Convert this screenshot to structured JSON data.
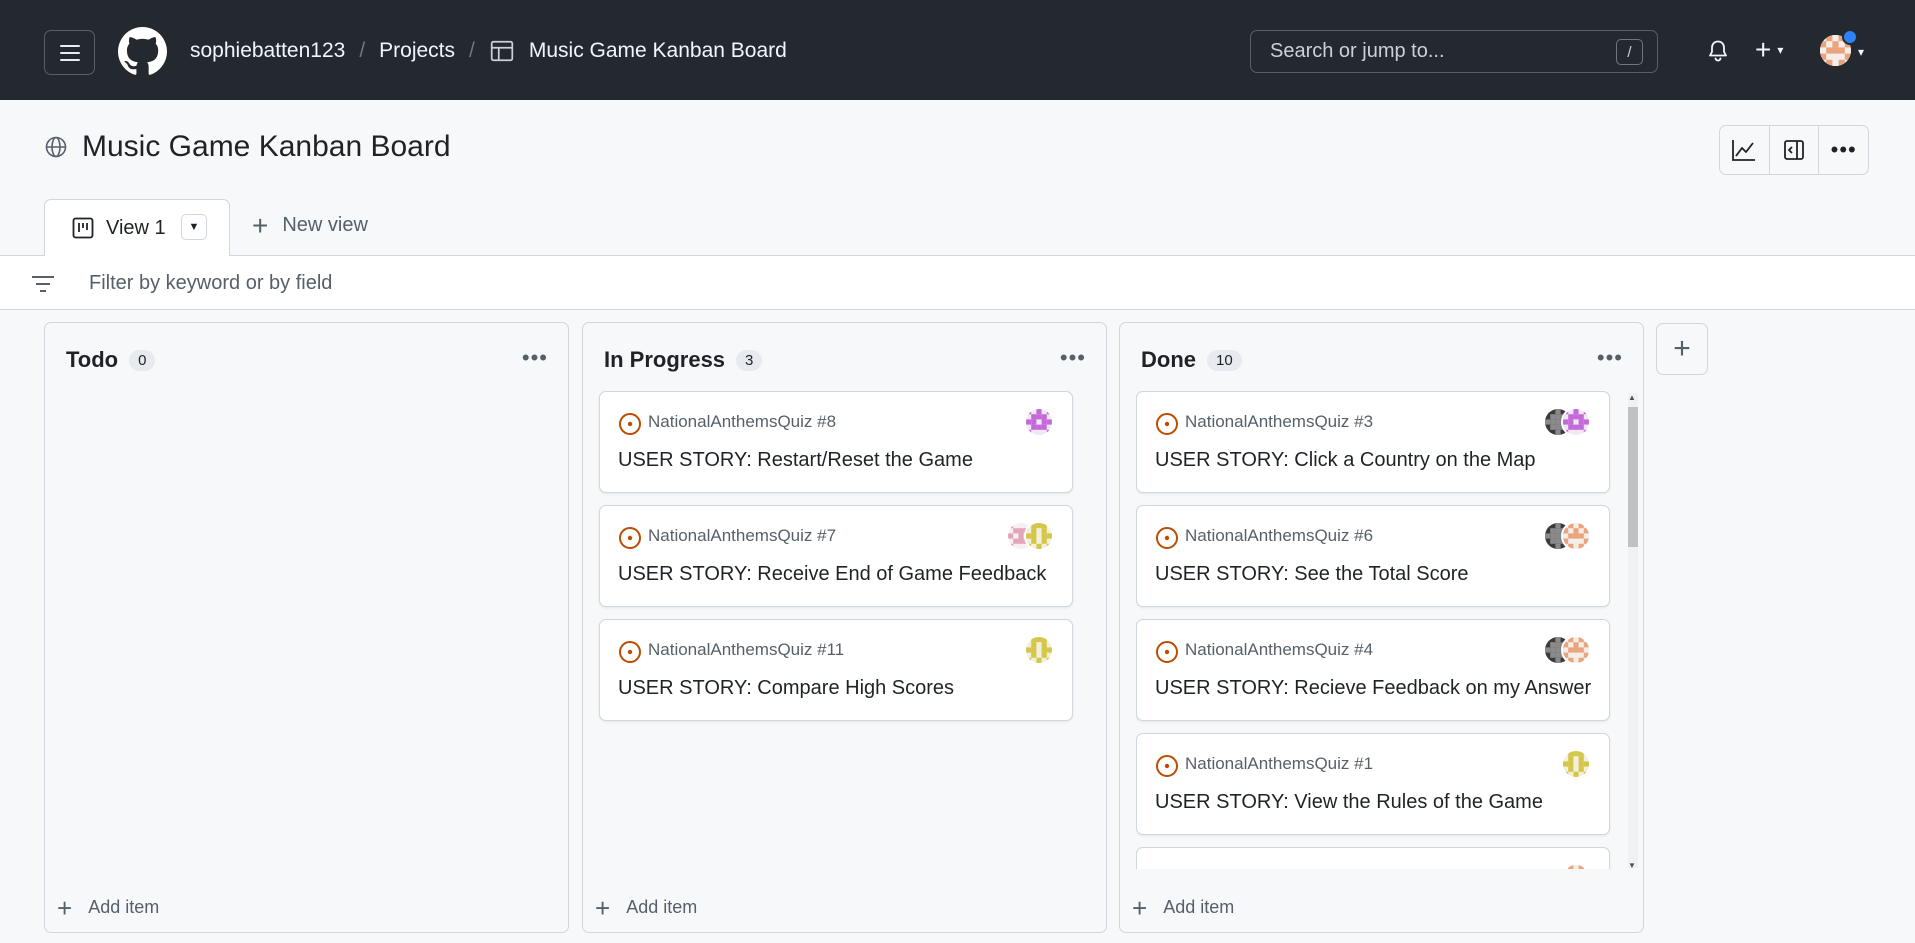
{
  "header": {
    "owner": "sophiebatten123",
    "projects_label": "Projects",
    "project_name": "Music Game Kanban Board",
    "search_placeholder": "Search or jump to...",
    "search_shortcut": "/"
  },
  "project": {
    "title": "Music Game Kanban Board"
  },
  "tabs": {
    "active_label": "View 1",
    "new_view_label": "New view"
  },
  "filter": {
    "placeholder": "Filter by keyword or by field"
  },
  "columns": [
    {
      "name": "Todo",
      "count": "0",
      "add_label": "Add item",
      "cards": []
    },
    {
      "name": "In Progress",
      "count": "3",
      "add_label": "Add item",
      "cards": [
        {
          "ref": "NationalAnthemsQuiz #8",
          "title": "USER STORY: Restart/Reset the Game",
          "avatars": [
            "purple"
          ]
        },
        {
          "ref": "NationalAnthemsQuiz #7",
          "title": "USER STORY: Receive End of Game Feedback",
          "avatars": [
            "pink",
            "yellow"
          ]
        },
        {
          "ref": "NationalAnthemsQuiz #11",
          "title": "USER STORY: Compare High Scores",
          "avatars": [
            "yellow"
          ]
        }
      ]
    },
    {
      "name": "Done",
      "count": "10",
      "add_label": "Add item",
      "cards": [
        {
          "ref": "NationalAnthemsQuiz #3",
          "title": "USER STORY: Click a Country on the Map",
          "avatars": [
            "photo",
            "purple"
          ]
        },
        {
          "ref": "NationalAnthemsQuiz #6",
          "title": "USER STORY: See the Total Score",
          "avatars": [
            "photo",
            "orange"
          ]
        },
        {
          "ref": "NationalAnthemsQuiz #4",
          "title": "USER STORY: Recieve Feedback on my Answer",
          "avatars": [
            "photo",
            "orange"
          ]
        },
        {
          "ref": "NationalAnthemsQuiz #1",
          "title": "USER STORY: View the Rules of the Game",
          "avatars": [
            "yellow"
          ]
        },
        {
          "ref": "",
          "title": "",
          "avatars": [
            "orange"
          ]
        }
      ]
    }
  ],
  "colors": {
    "header_bg": "#24292f",
    "issue_open": "#bc4c00",
    "accent_blue": "#2f81f7"
  }
}
